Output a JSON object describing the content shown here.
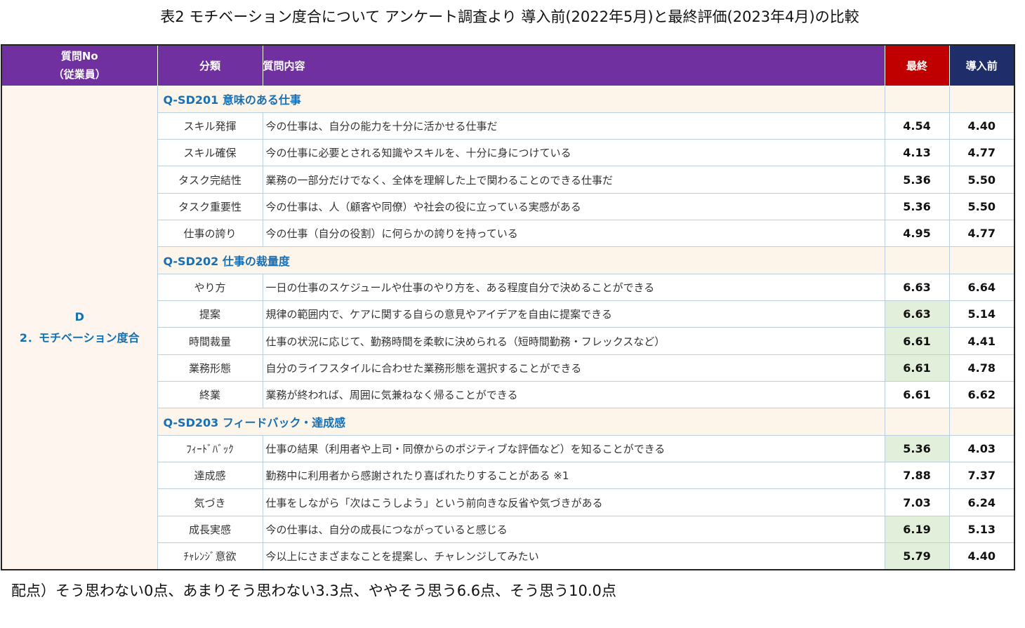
{
  "title": "表2  モチベーション度合について  アンケート調査より  導入前(2022年5月)と最終評価(2023年4月)の比較",
  "header": {
    "q_no_line1": "質問No",
    "q_no_line2": "（従業員）",
    "category": "分類",
    "content": "質問内容",
    "final": "最終",
    "before": "導入前"
  },
  "group": {
    "line1": "D",
    "line2": "2．モチベーション度合"
  },
  "sections": [
    {
      "title": "Q-SD201 意味のある仕事",
      "rows": [
        {
          "category": "スキル発揮",
          "content": "今の仕事は、自分の能力を十分に活かせる仕事だ",
          "final": "4.54",
          "before": "4.40",
          "highlight": false
        },
        {
          "category": "スキル確保",
          "content": "今の仕事に必要とされる知識やスキルを、十分に身につけている",
          "final": "4.13",
          "before": "4.77",
          "highlight": false
        },
        {
          "category": "タスク完結性",
          "content": "業務の一部分だけでなく、全体を理解した上で関わることのできる仕事だ",
          "final": "5.36",
          "before": "5.50",
          "highlight": false
        },
        {
          "category": "タスク重要性",
          "content": "今の仕事は、人（顧客や同僚）や社会の役に立っている実感がある",
          "final": "5.36",
          "before": "5.50",
          "highlight": false
        },
        {
          "category": "仕事の誇り",
          "content": "今の仕事（自分の役割）に何らかの誇りを持っている",
          "final": "4.95",
          "before": "4.77",
          "highlight": false
        }
      ]
    },
    {
      "title": "Q-SD202 仕事の裁量度",
      "rows": [
        {
          "category": "やり方",
          "content": "一日の仕事のスケジュールや仕事のやり方を、ある程度自分で決めることができる",
          "final": "6.63",
          "before": "6.64",
          "highlight": false
        },
        {
          "category": "提案",
          "content": "規律の範囲内で、ケアに関する自らの意見やアイデアを自由に提案できる",
          "final": "6.63",
          "before": "5.14",
          "highlight": true
        },
        {
          "category": "時間裁量",
          "content": "仕事の状況に応じて、勤務時間を柔軟に決められる（短時間勤務・フレックスなど）",
          "final": "6.61",
          "before": "4.41",
          "highlight": true
        },
        {
          "category": "業務形態",
          "content": "自分のライフスタイルに合わせた業務形態を選択することができる",
          "final": "6.61",
          "before": "4.78",
          "highlight": true
        },
        {
          "category": "終業",
          "content": "業務が終われば、周囲に気兼ねなく帰ることができる",
          "final": "6.61",
          "before": "6.62",
          "highlight": false
        }
      ]
    },
    {
      "title": "Q-SD203 フィードバック・達成感",
      "rows": [
        {
          "category": "ﾌｨｰﾄﾞﾊﾞｯｸ",
          "content": "仕事の結果（利用者や上司・同僚からのポジティブな評価など）を知ることができる",
          "final": "5.36",
          "before": "4.03",
          "highlight": true
        },
        {
          "category": "達成感",
          "content": "勤務中に利用者から感謝されたり喜ばれたりすることがある ※1",
          "final": "7.88",
          "before": "7.37",
          "highlight": false
        },
        {
          "category": "気づき",
          "content": "仕事をしながら「次はこうしよう」という前向きな反省や気づきがある",
          "final": "7.03",
          "before": "6.24",
          "highlight": false
        },
        {
          "category": "成長実感",
          "content": "今の仕事は、自分の成長につながっていると感じる",
          "final": "6.19",
          "before": "5.13",
          "highlight": true
        },
        {
          "category": "ﾁｬﾚﾝｼﾞ意欲",
          "content": "今以上にさまざまなことを提案し、チャレンジしてみたい",
          "final": "5.79",
          "before": "4.40",
          "highlight": true
        }
      ]
    }
  ],
  "note": "配点）そう思わない0点、あまりそう思わない3.3点、ややそう思う6.6点、そう思う10.0点",
  "colors": {
    "header_bg": "#7030a0",
    "final_bg": "#c00000",
    "before_bg": "#1f2d6b",
    "highlight_bg": "#e2efda",
    "section_bg": "#fdf4ea",
    "section_text": "#1a6fb0"
  }
}
